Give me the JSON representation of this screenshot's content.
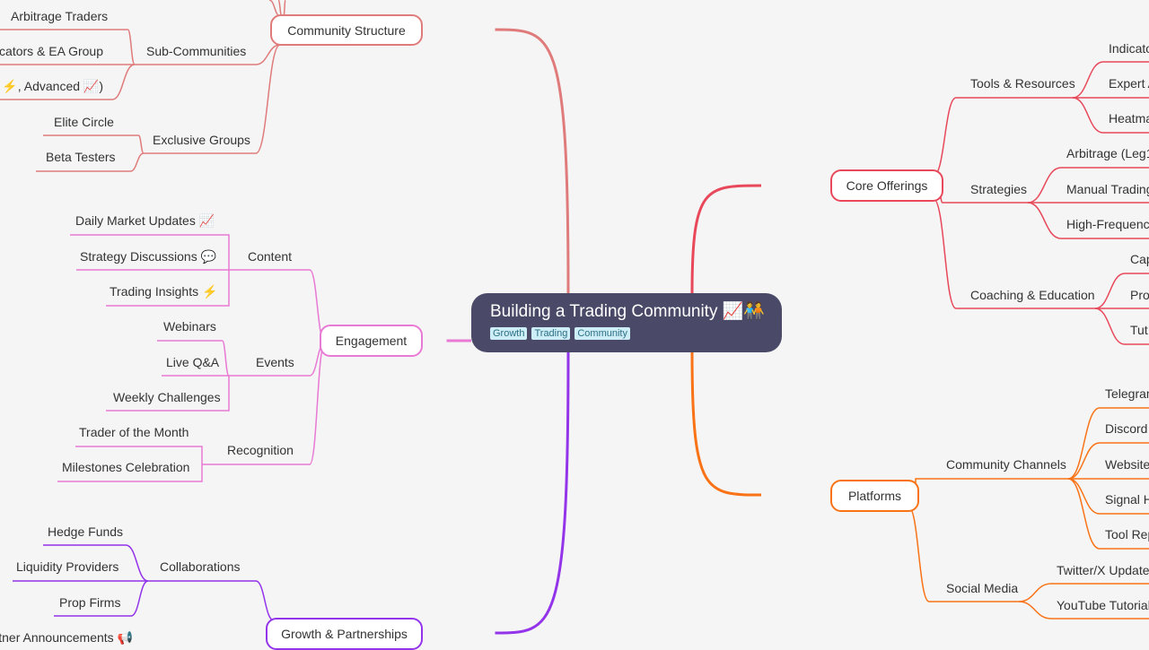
{
  "root": {
    "title": "Building a Trading Community 📈🧑‍🤝‍🧑",
    "tags": [
      "Growth",
      "Trading",
      "Community"
    ]
  },
  "branches": [
    {
      "label": "Community Structure",
      "color": "#e07b7b",
      "children": [
        {
          "label": "Sub-Communities",
          "children": [
            "Arbitrage Traders",
            "Indicators & EA Group",
            "ate ⚡, Advanced 📈)"
          ]
        },
        {
          "label": "Exclusive Groups",
          "children": [
            "Elite Circle",
            "Beta Testers"
          ]
        }
      ]
    },
    {
      "label": "Engagement",
      "color": "#e879d4",
      "children": [
        {
          "label": "Content",
          "children": [
            "Daily Market Updates 📈",
            "Strategy Discussions 💬",
            "Trading Insights ⚡"
          ]
        },
        {
          "label": "Events",
          "children": [
            "Webinars",
            "Live Q&A",
            "Weekly Challenges"
          ]
        },
        {
          "label": "Recognition",
          "children": [
            "Trader of the Month",
            "Milestones Celebration"
          ]
        }
      ]
    },
    {
      "label": "Growth & Partnerships",
      "color": "#9333ea",
      "children": [
        {
          "label": "Collaborations",
          "children": [
            "Hedge Funds",
            "Liquidity Providers",
            "Prop Firms"
          ]
        },
        {
          "label": "",
          "children": [
            "Partner Announcements 📢"
          ]
        }
      ]
    },
    {
      "label": "Core Offerings",
      "color": "#e8485a",
      "children": [
        {
          "label": "Tools & Resources",
          "children": [
            "Indicato",
            "Expert A",
            "Heatma"
          ]
        },
        {
          "label": "Strategies",
          "children": [
            "Arbitrage (Leg1,",
            "Manual Trading",
            "High-Frequency"
          ]
        },
        {
          "label": "Coaching & Education",
          "children": [
            "Cap",
            "Pro",
            "Tut"
          ]
        }
      ]
    },
    {
      "label": "Platforms",
      "color": "#f97316",
      "children": [
        {
          "label": "Community Channels",
          "children": [
            "Telegram",
            "Discord",
            "Website,",
            "Signal H",
            "Tool Rep"
          ]
        },
        {
          "label": "Social Media",
          "children": [
            "Twitter/X Updates",
            "YouTube Tutorials"
          ]
        }
      ]
    }
  ]
}
